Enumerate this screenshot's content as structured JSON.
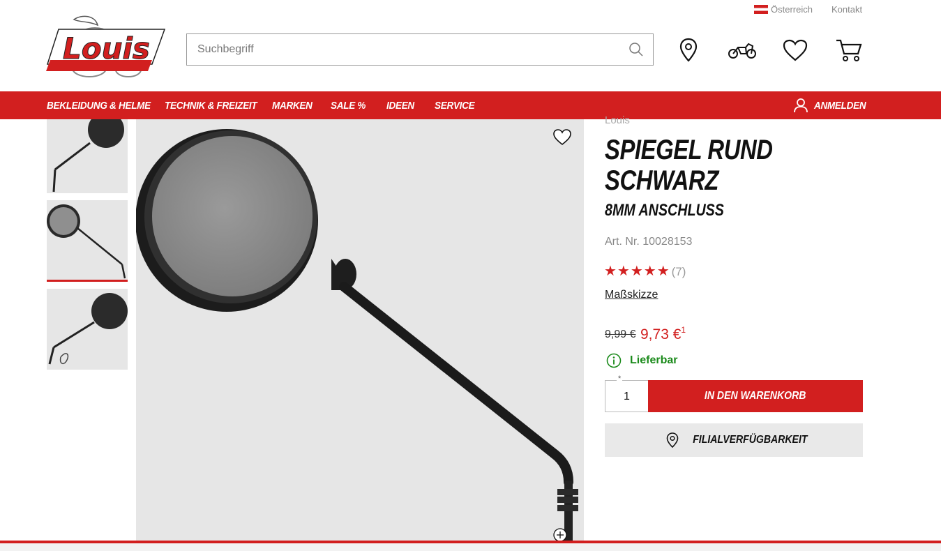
{
  "header": {
    "country": "Österreich",
    "contact": "Kontakt",
    "logo_text": "Louis",
    "search_placeholder": "Suchbegriff"
  },
  "header_icons": [
    "location-pin-icon",
    "motorcycle-icon",
    "heart-icon",
    "cart-icon"
  ],
  "nav": {
    "items": [
      "BEKLEIDUNG & HELME",
      "TECHNIK & FREIZEIT",
      "MARKEN",
      "SALE %",
      "IDEEN",
      "SERVICE"
    ],
    "login": "ANMELDEN"
  },
  "product": {
    "brand": "Louis",
    "title": "SPIEGEL RUND SCHWARZ",
    "subtitle": "8MM ANSCHLUSS",
    "article_number": "Art. Nr. 10028153",
    "rating_stars": "★★★★★",
    "rating": 5,
    "rating_count": "(7)",
    "dimension_sketch": "Maßskizze",
    "old_price": "9,99 €",
    "new_price": "9,73 €",
    "price_footnote": "1",
    "availability": "Lieferbar",
    "quantity": "1",
    "quantity_required_mark": "*",
    "add_to_cart": "IN DEN WARENKORB",
    "store_availability": "FILIALVERFÜGBARKEIT"
  },
  "colors": {
    "brand_red": "#d21f1f",
    "available_green": "#1a8a1a",
    "image_bg": "#e6e6e6"
  }
}
